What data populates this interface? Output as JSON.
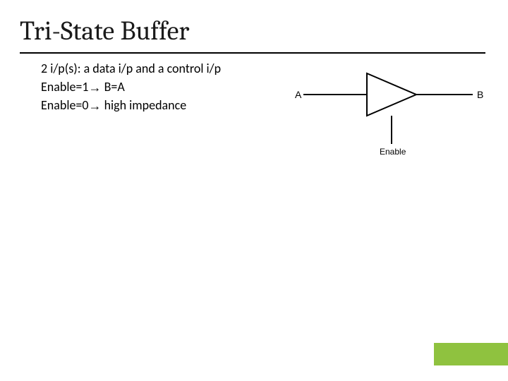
{
  "title": "Tri-State Buffer",
  "bullets": {
    "line1_left": "2 i/p(s): a data i/p and a control i/p",
    "line2_left": "Enable=1",
    "line2_arrow": "→",
    "line2_right": " B=A",
    "line3_left": "Enable=0",
    "line3_arrow": "→",
    "line3_right": " high impedance"
  },
  "figure": {
    "input_label": "A",
    "output_label": "B",
    "control_label": "Enable"
  },
  "accent_color": "#8fc23f"
}
